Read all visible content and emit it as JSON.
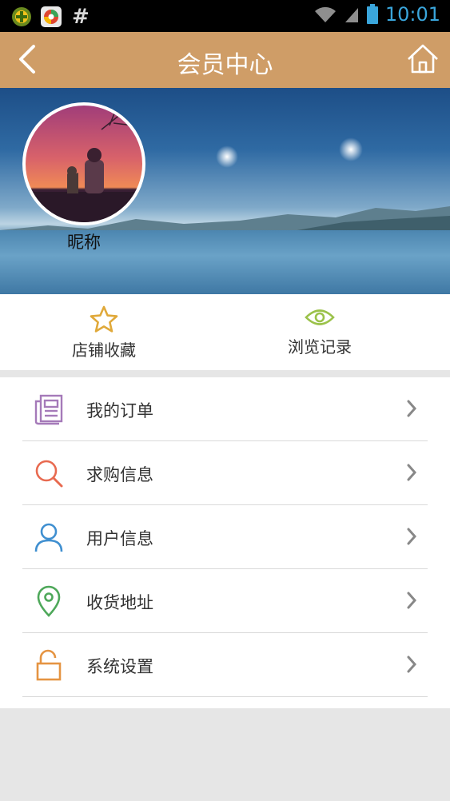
{
  "status_bar": {
    "time": "10:01",
    "icons": [
      "app-icon-1",
      "app-icon-2",
      "hash-icon",
      "wifi-icon",
      "signal-icon",
      "battery-icon"
    ]
  },
  "header": {
    "title": "会员中心",
    "back_icon": "chevron-left-icon",
    "home_icon": "home-icon",
    "background": "#cf9d67"
  },
  "profile": {
    "nickname": "昵称"
  },
  "quick_actions": [
    {
      "label": "店铺收藏",
      "icon": "star-icon",
      "color": "#e0a93a"
    },
    {
      "label": "浏览记录",
      "icon": "eye-icon",
      "color": "#9bc24a"
    }
  ],
  "menu": [
    {
      "label": "我的订单",
      "icon": "order-document-icon",
      "color": "#a57ab9"
    },
    {
      "label": "求购信息",
      "icon": "search-icon",
      "color": "#e86a50"
    },
    {
      "label": "用户信息",
      "icon": "user-icon",
      "color": "#3f8fd0"
    },
    {
      "label": "收货地址",
      "icon": "location-pin-icon",
      "color": "#4ea85a"
    },
    {
      "label": "系统设置",
      "icon": "unlock-icon",
      "color": "#e59442"
    }
  ]
}
